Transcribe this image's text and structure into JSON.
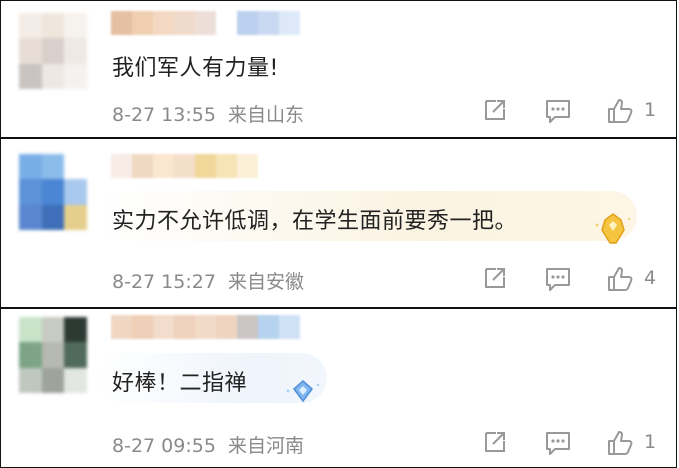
{
  "comments": [
    {
      "text": "我们军人有力量!",
      "time": "8-27 13:55",
      "location": "来自山东",
      "likes": "1",
      "avatar_colors": [
        "#f4ece6",
        "#efe6dc",
        "#f6f2ee",
        "#e8ddd6",
        "#d9d0cb",
        "#efe9e4",
        "#c9c3c1",
        "#eee8e5",
        "#f5f1ef"
      ],
      "name_colors": [
        "#e6c0a2",
        "#f0cfb0",
        "#f3d9c3",
        "#f0dacb",
        "#eddfd8",
        "#ffffff",
        "#bcd0ef",
        "#cad9f2",
        "#dde8f8"
      ]
    },
    {
      "text": "实力不允许低调，在学生面前要秀一把。",
      "time": "8-27 15:27",
      "location": "来自安徽",
      "likes": "4",
      "avatar_colors": [
        "#78aee6",
        "#8cbcea",
        "#ffffff",
        "#5b92d8",
        "#4a86d3",
        "#a9c9ee",
        "#5b86cf",
        "#3e6fb8",
        "#e6cf8c"
      ],
      "name_colors": [
        "#f7ece6",
        "#f0d9c2",
        "#fbe7cf",
        "#f4dfcb",
        "#f2d79a",
        "#f6e4b6",
        "#fbefd7"
      ]
    },
    {
      "text": "好棒！二指禅",
      "time": "8-27 09:55",
      "location": "来自河南",
      "likes": "1",
      "avatar_colors": [
        "#c9e3c9",
        "#c7cbc1",
        "#2d3a34",
        "#7da486",
        "#b6b9b1",
        "#506a5c",
        "#bfc8bf",
        "#9ea49c",
        "#e3e7e2"
      ],
      "name_colors": [
        "#f0d7c4",
        "#efcfb8",
        "#f3dccb",
        "#efd2bd",
        "#f2dac8",
        "#efd5c0",
        "#cbc6c4",
        "#b5d2ef",
        "#cfe1f5"
      ]
    }
  ],
  "colors": {
    "text": "#222222",
    "meta": "#8a8a8a",
    "border": "#111111",
    "gold_bubble": "#fbf3e2",
    "blue_bubble": "#eef4fb"
  }
}
